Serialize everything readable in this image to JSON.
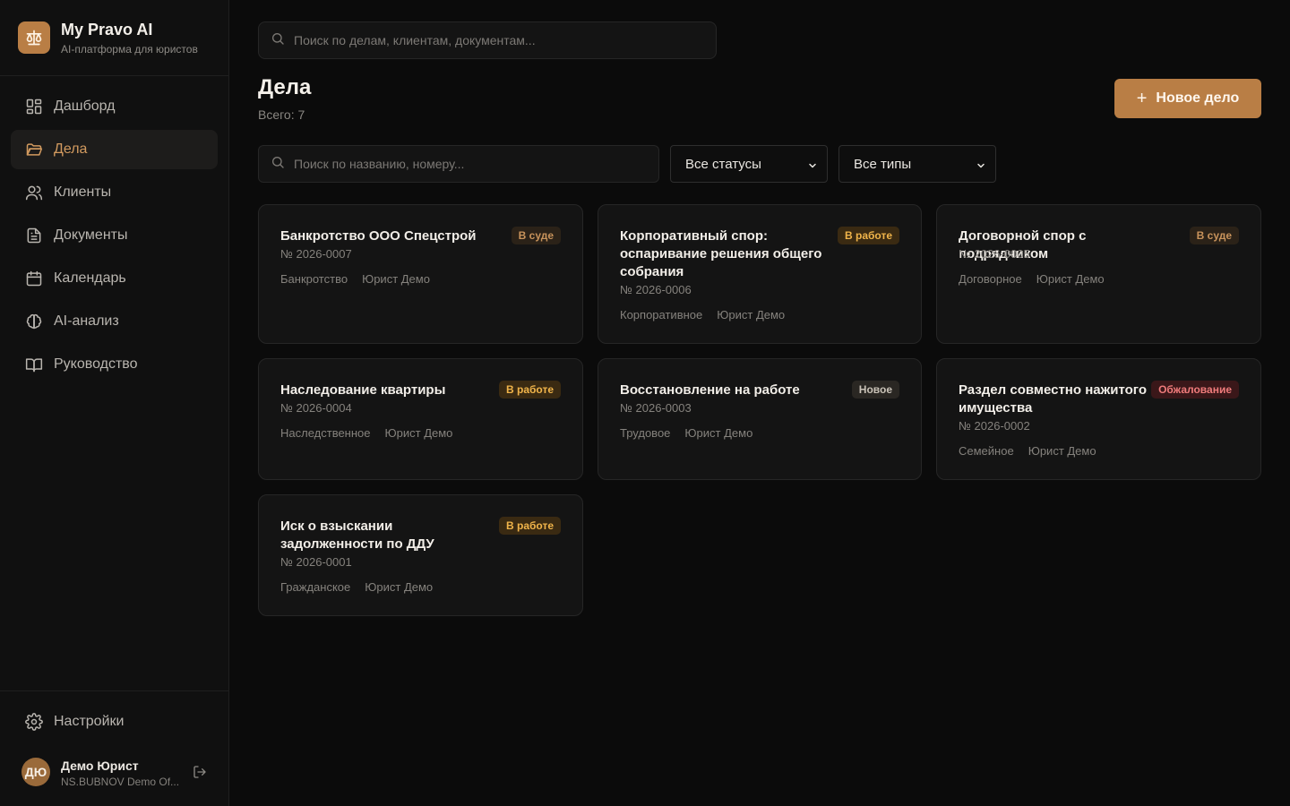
{
  "brand": {
    "name": "My Pravo AI",
    "subtitle": "AI-платформа для юристов"
  },
  "sidebar": {
    "items": [
      {
        "label": "Дашборд",
        "icon": "dashboard-icon",
        "active": false
      },
      {
        "label": "Дела",
        "icon": "folder-icon",
        "active": true
      },
      {
        "label": "Клиенты",
        "icon": "users-icon",
        "active": false
      },
      {
        "label": "Документы",
        "icon": "document-icon",
        "active": false
      },
      {
        "label": "Календарь",
        "icon": "calendar-icon",
        "active": false
      },
      {
        "label": "AI-анализ",
        "icon": "brain-icon",
        "active": false
      },
      {
        "label": "Руководство",
        "icon": "book-icon",
        "active": false
      }
    ],
    "settings_label": "Настройки"
  },
  "user": {
    "initials": "ДЮ",
    "name": "Демо Юрист",
    "org": "NS.BUBNOV Demo Of..."
  },
  "global_search": {
    "placeholder": "Поиск по делам, клиентам, документам..."
  },
  "page": {
    "title": "Дела",
    "count": "Всего: 7",
    "new_button": "Новое дело"
  },
  "filters": {
    "search_placeholder": "Поиск по названию, номеру...",
    "status": "Все статусы",
    "type": "Все типы"
  },
  "cases": [
    {
      "title": "Банкротство ООО Спецстрой",
      "number": "№ 2026-0007",
      "type": "Банкротство",
      "lawyer": "Юрист Демо",
      "status": "В суде",
      "status_kind": "court"
    },
    {
      "title": "Корпоративный спор: оспаривание решения общего собрания",
      "number": "№ 2026-0006",
      "type": "Корпоративное",
      "lawyer": "Юрист Демо",
      "status": "В работе",
      "status_kind": "work"
    },
    {
      "title": "Договорной спор с подрядчиком",
      "number": "№ 2026-0005",
      "type": "Договорное",
      "lawyer": "Юрист Демо",
      "status": "В суде",
      "status_kind": "court"
    },
    {
      "title": "Наследование квартиры",
      "number": "№ 2026-0004",
      "type": "Наследственное",
      "lawyer": "Юрист Демо",
      "status": "В работе",
      "status_kind": "work"
    },
    {
      "title": "Восстановление на работе",
      "number": "№ 2026-0003",
      "type": "Трудовое",
      "lawyer": "Юрист Демо",
      "status": "Новое",
      "status_kind": "new"
    },
    {
      "title": "Раздел совместно нажитого имущества",
      "number": "№ 2026-0002",
      "type": "Семейное",
      "lawyer": "Юрист Демо",
      "status": "Обжалование",
      "status_kind": "appeal"
    },
    {
      "title": "Иск о взыскании задолженности по ДДУ",
      "number": "№ 2026-0001",
      "type": "Гражданское",
      "lawyer": "Юрист Демо",
      "status": "В работе",
      "status_kind": "work"
    }
  ],
  "colors": {
    "accent": "#b97e45",
    "background": "#0b0b0b",
    "card": "#141414"
  }
}
